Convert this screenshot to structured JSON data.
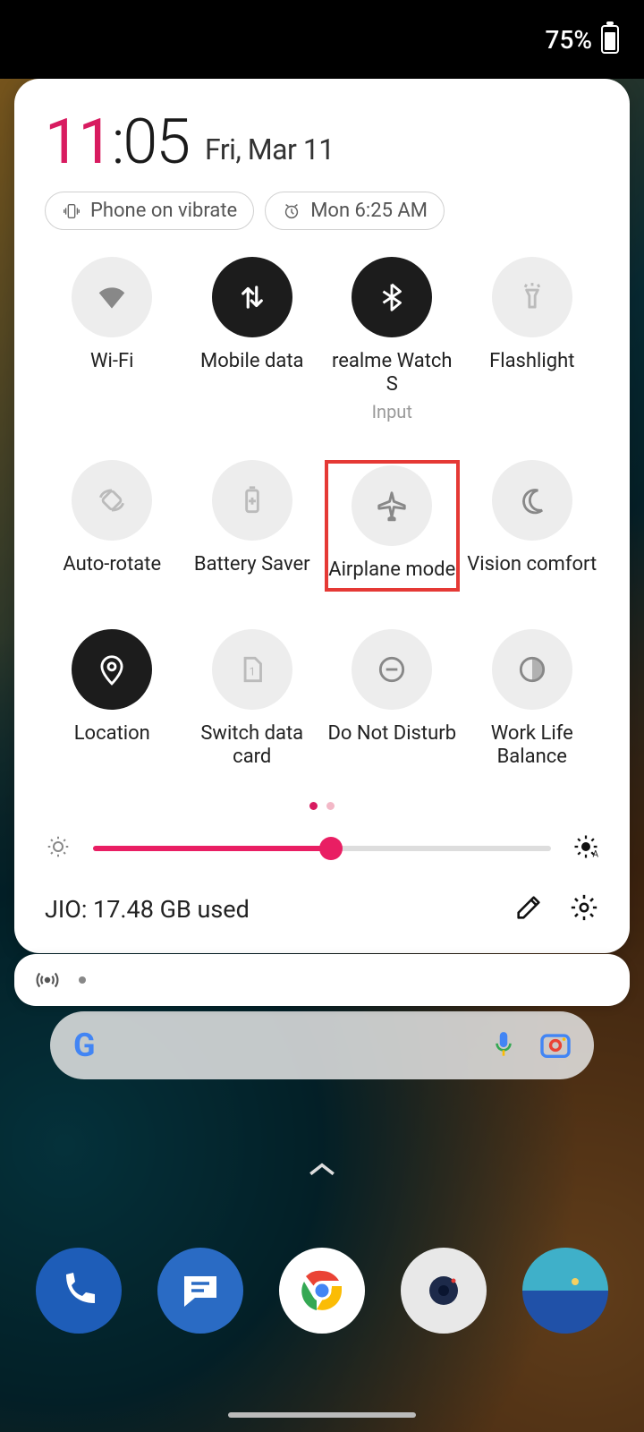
{
  "status_bar": {
    "battery_pct": "75%"
  },
  "clock": {
    "hours": "11",
    "sep": ":",
    "minutes": "05",
    "date": "Fri, Mar 11"
  },
  "chips": {
    "vibrate": "Phone on vibrate",
    "alarm": "Mon 6:25 AM"
  },
  "tiles": [
    {
      "id": "wifi",
      "label": "Wi-Fi",
      "state": "off"
    },
    {
      "id": "mobile-data",
      "label": "Mobile data",
      "state": "on"
    },
    {
      "id": "bt-watch",
      "label": "realme Watch S",
      "sub": "Input",
      "state": "on"
    },
    {
      "id": "flashlight",
      "label": "Flashlight",
      "state": "dim"
    },
    {
      "id": "auto-rotate",
      "label": "Auto-rotate",
      "state": "dim"
    },
    {
      "id": "battery-saver",
      "label": "Battery Saver",
      "state": "dim"
    },
    {
      "id": "airplane",
      "label": "Airplane mode",
      "state": "off",
      "highlight": true
    },
    {
      "id": "vision",
      "label": "Vision comfort",
      "state": "off"
    },
    {
      "id": "location",
      "label": "Location",
      "state": "on"
    },
    {
      "id": "switch-sim",
      "label": "Switch data card",
      "state": "dim"
    },
    {
      "id": "dnd",
      "label": "Do Not Disturb",
      "state": "off"
    },
    {
      "id": "wlb",
      "label": "Work Life Balance",
      "state": "off"
    }
  ],
  "pager": {
    "count": 2,
    "active": 0
  },
  "brightness_pct": 52,
  "data_usage": "JIO: 17.48 GB used",
  "dock": [
    "Phone",
    "Messages",
    "Chrome",
    "Camera",
    "Gallery"
  ]
}
